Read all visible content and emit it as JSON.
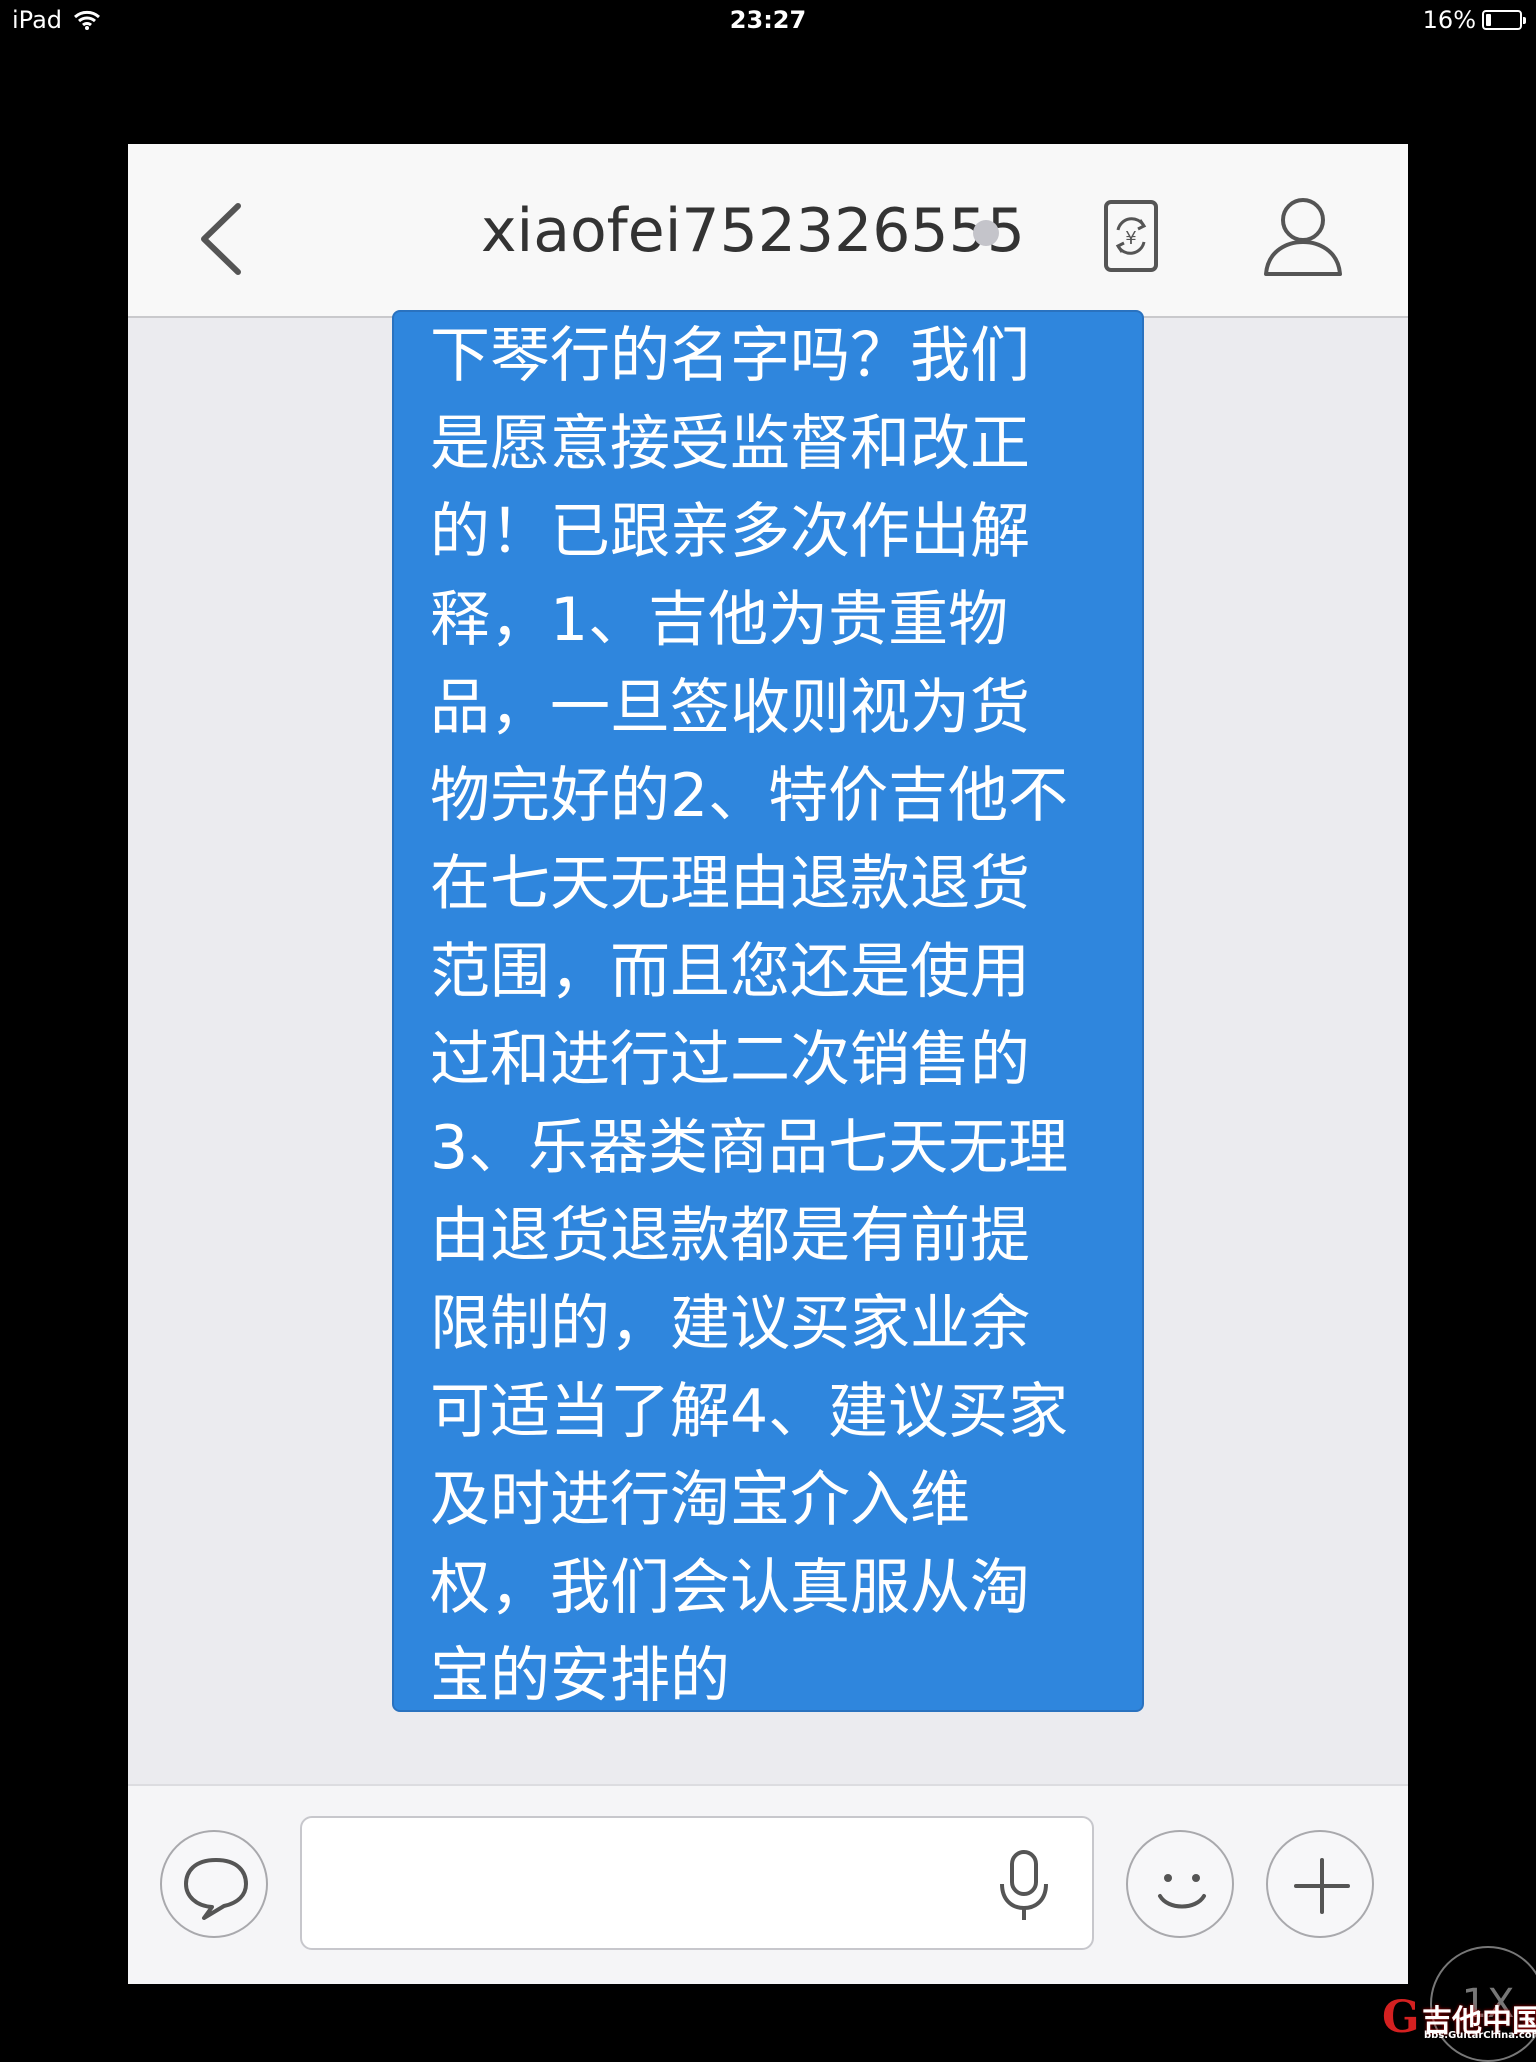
{
  "status_bar": {
    "device": "iPad",
    "time": "23:27",
    "battery_text": "16%",
    "battery_level": 0.16
  },
  "nav": {
    "title": "xiaofei752326555",
    "back_icon": "chevron-left-icon",
    "pay_icon": "yen-transfer-icon",
    "profile_icon": "person-icon"
  },
  "message": {
    "lines": [
      "下琴行的名字吗？我们",
      "是愿意接受监督和改正",
      "的！已跟亲多次作出解",
      "释，1、吉他为贵重物",
      "品，一旦签收则视为货",
      "物完好的2、特价吉他不",
      "在七天无理由退款退货",
      "范围，而且您还是使用",
      "过和进行过二次销售的",
      "3、乐器类商品七天无理",
      "由退货退款都是有前提",
      "限制的，建议买家业余",
      "可适当了解4、建议买家",
      "及时进行淘宝介入维",
      "权，我们会认真服从淘",
      "宝的安排的"
    ]
  },
  "input_bar": {
    "message_value": "",
    "left_icon": "chat-bubble-icon",
    "mic_icon": "microphone-icon",
    "emoji_icon": "smiley-icon",
    "plus_icon": "plus-icon"
  },
  "overlay": {
    "zoom_label": "1X",
    "watermark_title": "吉他中国",
    "watermark_url": "bbs.GuitarChina.com"
  },
  "colors": {
    "bubble": "#2f86dd",
    "background": "#ebebef",
    "navbar": "#f8f8f8"
  }
}
